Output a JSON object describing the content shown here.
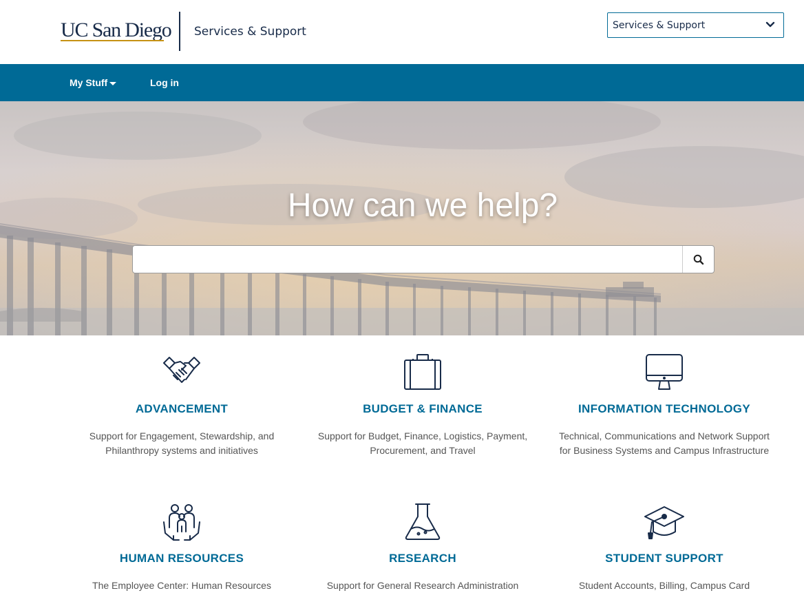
{
  "header": {
    "logo_text": "UC San Diego",
    "site_title": "Services & Support",
    "site_select": {
      "selected": "Services & Support"
    }
  },
  "nav": {
    "items": [
      {
        "label": "My Stuff",
        "has_dropdown": true
      },
      {
        "label": "Log in"
      }
    ]
  },
  "hero": {
    "heading": "How can we help?",
    "search": {
      "value": "",
      "placeholder": ""
    }
  },
  "colors": {
    "brand_navy": "#182b49",
    "brand_blue": "#006a96",
    "brand_gold": "#c69214"
  },
  "cards": [
    {
      "title": "ADVANCEMENT",
      "description": "Support for Engagement, Stewardship, and Philanthropy systems and initiatives",
      "icon": "handshake-icon"
    },
    {
      "title": "BUDGET & FINANCE",
      "description": "Support for Budget, Finance, Logistics, Payment, Procurement, and Travel",
      "icon": "briefcase-icon"
    },
    {
      "title": "INFORMATION TECHNOLOGY",
      "description": "Technical, Communications and Network Support for Business Systems and Campus Infrastructure",
      "icon": "monitor-icon"
    },
    {
      "title": "HUMAN RESOURCES",
      "description": "The Employee Center: Human Resources",
      "icon": "people-hands-icon"
    },
    {
      "title": "RESEARCH",
      "description": "Support for General Research Administration",
      "icon": "flask-icon"
    },
    {
      "title": "STUDENT SUPPORT",
      "description": "Student Accounts, Billing, Campus Card",
      "icon": "graduation-cap-icon"
    }
  ]
}
